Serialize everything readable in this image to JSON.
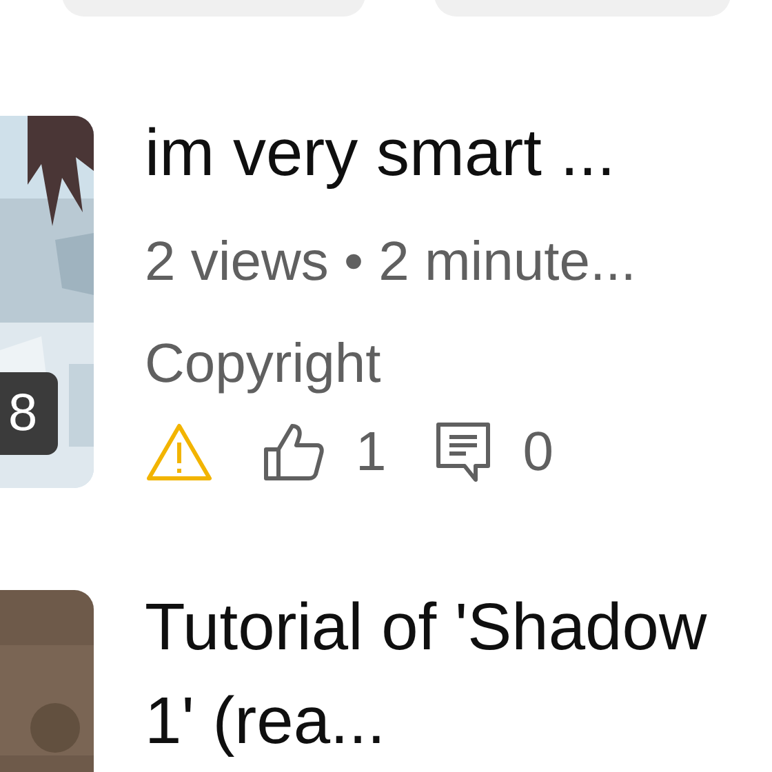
{
  "videos": [
    {
      "title": "im very smart ...",
      "duration": "8",
      "meta": "2 views • 2 minute...",
      "restriction": "Copyright",
      "warning": true,
      "likes": "1",
      "comments": "0"
    },
    {
      "title": "Tutorial of 'Shadow 1' (rea..."
    }
  ]
}
